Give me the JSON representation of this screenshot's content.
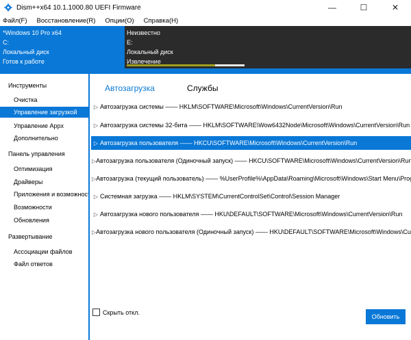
{
  "window": {
    "title": "Dism++x64 10.1.1000.80 UEFI Firmware",
    "minimize_glyph": "—",
    "maximize_glyph": "☐",
    "close_glyph": "✕"
  },
  "menu": {
    "items": [
      "Файл(F)",
      "Восстановление(R)",
      "Опции(O)",
      "Справка(H)"
    ]
  },
  "info_left": {
    "os_name": "*Windows 10 Pro x64",
    "drive": "C:",
    "disk_type": "Локальный диск",
    "status": "Готов к работе"
  },
  "info_right": {
    "line1": "Неизвестно",
    "line2": "E:",
    "line3": "Локальный диск",
    "line4": "Извлечение",
    "progress": 0.75
  },
  "sidebar": {
    "category_tools": "Инструменты",
    "category_panel": "Панель управления",
    "category_deploy": "Развертывание",
    "tools_items": [
      "Очистка",
      "Управление загрузкой",
      "Управление Appx",
      "Дополнительно"
    ],
    "panel_items": [
      "Оптимизация",
      "Драйверы",
      "Приложения и возможности",
      "Возможности",
      "Обновления"
    ],
    "deploy_items": [
      "Ассоциации файлов",
      "Файл ответов"
    ],
    "active_item": "Управление загрузкой"
  },
  "tabs": {
    "autorun": "Автозагрузка",
    "services": "Службы"
  },
  "autorun_rows": [
    "Автозагрузка системы —— HKLM\\SOFTWARE\\Microsoft\\Windows\\CurrentVersion\\Run",
    "Автозагрузка системы 32-бита —— HKLM\\SOFTWARE\\Wow6432Node\\Microsoft\\Windows\\CurrentVersion\\Run",
    "Автозагрузка пользователя —— HKCU\\SOFTWARE\\Microsoft\\Windows\\CurrentVersion\\Run",
    "Автозагрузка пользователя (Одиночный запуск) —— HKCU\\SOFTWARE\\Microsoft\\Windows\\CurrentVersion\\RunO",
    "Автозагрузка (текущий пользователь) —— %UserProfile%\\AppData\\Roaming\\Microsoft\\Windows\\Start Menu\\Prog",
    "Системная загрузка —— HKLM\\SYSTEM\\CurrentControlSet\\Control\\Session Manager",
    "Автозагрузка нового пользователя —— HKU\\DEFAULT\\SOFTWARE\\Microsoft\\Windows\\CurrentVersion\\Run",
    "Автозагрузка нового пользователя (Одиночный запуск) —— HKU\\DEFAULT\\SOFTWARE\\Microsoft\\Windows\\CurrentVersion\\Run"
  ],
  "selected_row_index": 2,
  "footer": {
    "hide_disabled_label": "Скрыть откл.",
    "refresh_label": "Обновить"
  },
  "colors": {
    "accent": "#0a78d7",
    "dark_panel": "#2b2b2b",
    "progress": "#a0a020"
  }
}
